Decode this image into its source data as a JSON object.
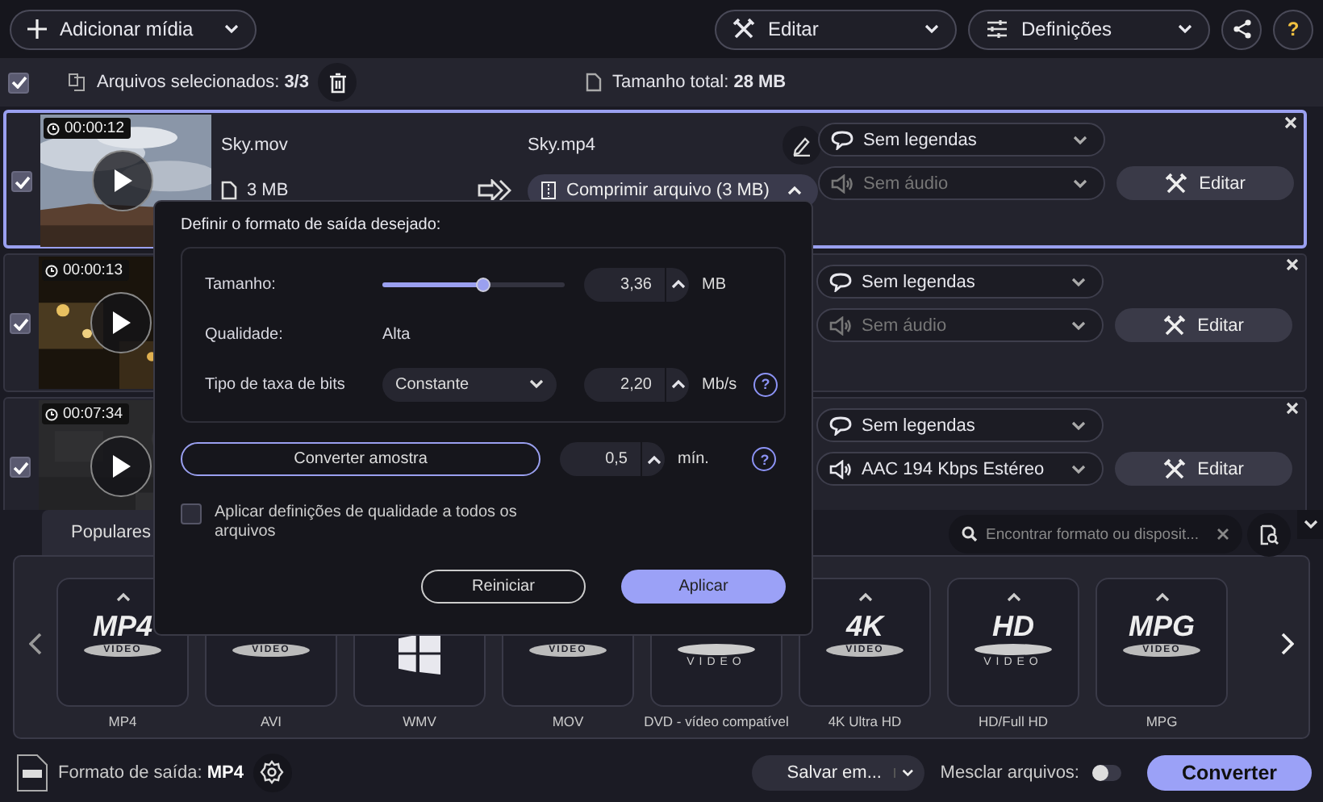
{
  "toolbar": {
    "add_media": "Adicionar mídia",
    "edit": "Editar",
    "settings": "Definições",
    "help": "?"
  },
  "selection_bar": {
    "all_checked": true,
    "selected_label": "Arquivos selecionados:",
    "selected_count": "3/3",
    "total_label": "Tamanho total:",
    "total_value": "28 MB"
  },
  "files": [
    {
      "checked": true,
      "selected": true,
      "duration": "00:00:12",
      "source_name": "Sky.mov",
      "source_size": "3 MB",
      "output_name": "Sky.mp4",
      "compress": "Comprimir arquivo (3 MB)",
      "compress_expanded": true,
      "subtitles": "Sem legendas",
      "audio": "Sem áudio",
      "audio_disabled": true,
      "edit": "Editar"
    },
    {
      "checked": true,
      "selected": false,
      "duration": "00:00:13",
      "subtitles": "Sem legendas",
      "audio": "Sem áudio",
      "audio_disabled": true,
      "edit": "Editar"
    },
    {
      "checked": true,
      "selected": false,
      "duration": "00:07:34",
      "subtitles": "Sem legendas",
      "audio": "AAC 194 Kbps Estéreo",
      "audio_disabled": false,
      "edit": "Editar"
    }
  ],
  "compress_popup": {
    "title": "Definir o formato de saída desejado:",
    "size_label": "Tamanho:",
    "level": 0.55,
    "size_value": "3,36",
    "size_unit": "MB",
    "quality_label": "Qualidade:",
    "quality_value": "Alta",
    "bitrate_label": "Tipo de taxa de bits",
    "bitrate_type": "Constante",
    "bitrate_value": "2,20",
    "bitrate_unit": "Mb/s",
    "bitrate_help": "?",
    "sample_button": "Converter amostra",
    "sample_value": "0,5",
    "sample_unit": "mín.",
    "sample_help": "?",
    "apply_all_checked": false,
    "apply_all_label": "Aplicar definições de qualidade a todos os arquivos",
    "reset": "Reiniciar",
    "apply": "Aplicar"
  },
  "formats": {
    "tabs": [
      {
        "label": "Populares",
        "selected": true
      }
    ],
    "search_placeholder": "Encontrar formato ou disposit...",
    "items": [
      {
        "kind": "badge",
        "logo": "MP4",
        "sub": "VIDEO",
        "label": "MP4",
        "expand_caret": true
      },
      {
        "kind": "badge",
        "sub": "VIDEO",
        "label": "AVI"
      },
      {
        "kind": "windows",
        "label": "WMV"
      },
      {
        "kind": "badge",
        "sub": "VIDEO",
        "label": "MOV"
      },
      {
        "kind": "disc",
        "sub": "VIDEO",
        "label": "DVD - vídeo compatível"
      },
      {
        "kind": "badge",
        "logo": "4K",
        "sub": "VIDEO",
        "label": "4K Ultra HD",
        "expand_caret": true
      },
      {
        "kind": "disc",
        "logo": "HD",
        "sub": "VIDEO",
        "label": "HD/Full HD",
        "expand_caret": true
      },
      {
        "kind": "badge",
        "logo": "MPG",
        "sub": "VIDEO",
        "label": "MPG",
        "expand_caret": true
      }
    ]
  },
  "bottom_bar": {
    "output_label": "Formato de saída:",
    "output_value": "MP4",
    "save": "Salvar em...",
    "merge_label": "Mesclar arquivos:",
    "merge_on": false,
    "convert": "Converter"
  }
}
